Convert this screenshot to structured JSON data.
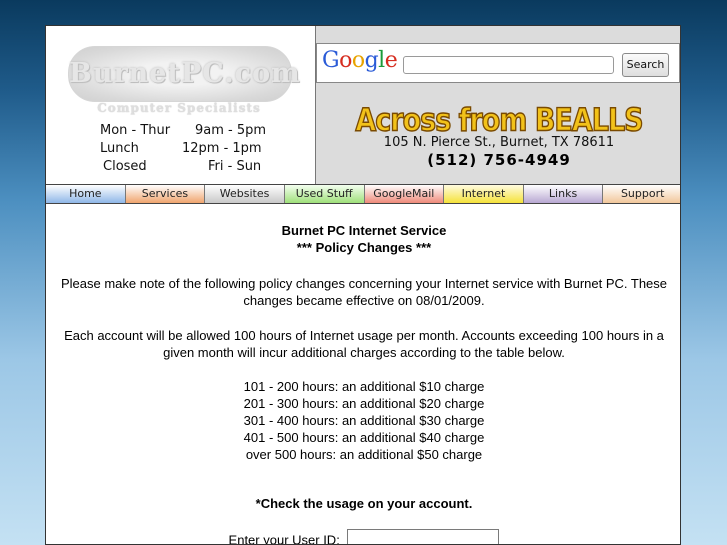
{
  "header": {
    "logo_text": "BurnetPC.com",
    "logo_subtitle": "Computer Specialists",
    "hours": [
      {
        "day": "Mon - Thur",
        "time": "9am - 5pm"
      },
      {
        "day": "Lunch",
        "time": "12pm - 1pm"
      },
      {
        "day": "Closed",
        "time": "Fri - Sun"
      }
    ],
    "google_logo": "Google",
    "search_placeholder": "",
    "search_button": "Search",
    "banner": "Across from BEALLS",
    "address": "105 N. Pierce St., Burnet, TX 78611",
    "phone": "(512) 756-4949"
  },
  "nav": {
    "items": [
      {
        "label": "Home",
        "color": "#8fb7e8"
      },
      {
        "label": "Services",
        "color": "#f0a56e"
      },
      {
        "label": "Websites",
        "color": "#c8c8c8"
      },
      {
        "label": "Used Stuff",
        "color": "#9fe07a"
      },
      {
        "label": "GoogleMail",
        "color": "#ef8a7a"
      },
      {
        "label": "Internet",
        "color": "#f5e23a"
      },
      {
        "label": "Links",
        "color": "#b8a8d2"
      },
      {
        "label": "Support",
        "color": "#f2c79b"
      }
    ]
  },
  "content": {
    "title": "Burnet PC Internet Service",
    "subtitle": "*** Policy Changes ***",
    "para1": "Please make note of the following policy changes concerning your Internet service with Burnet PC. These changes became effective on 08/01/2009.",
    "para2": "Each account will be allowed 100 hours of Internet usage per month. Accounts exceeding 100 hours in a given month will incur additional charges according to the table below.",
    "charges": [
      "101 - 200 hours: an additional $10 charge",
      "201 - 300 hours: an additional $20 charge",
      "301 - 400 hours: an additional $30 charge",
      "401 - 500 hours: an additional $40 charge",
      "over 500 hours: an additional $50 charge"
    ],
    "check_usage": "*Check the usage on your account.",
    "userid_label": "Enter your User ID:",
    "userid_value": ""
  }
}
